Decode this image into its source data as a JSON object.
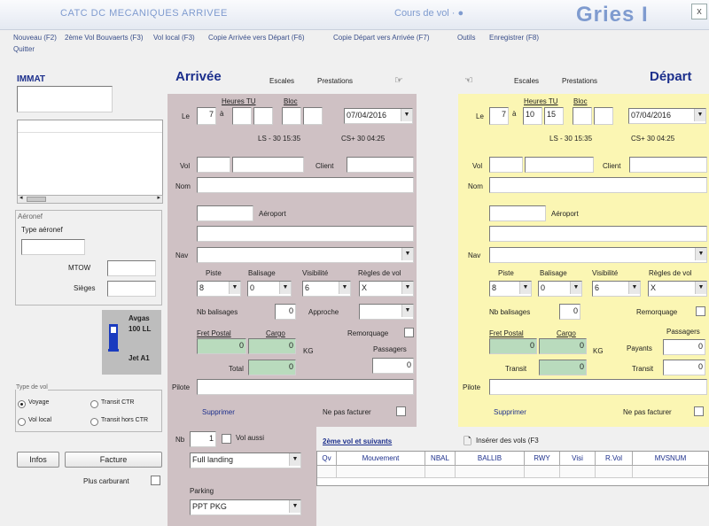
{
  "window": {
    "title": "CATC DC MECANIQUES ARRIVEE",
    "title_mid": "Cours de vol · ●",
    "title_big": "Gries I",
    "close_label": "x"
  },
  "menu": {
    "items": [
      "Nouveau (F2)",
      "2ème Vol Bouvaerts (F3)",
      "Vol local (F3)",
      "Copie Arrivée vers Départ (F6)",
      "Copie Départ vers Arrivée (F7)",
      "Outils",
      "Enregistrer (F8)"
    ],
    "quit": "Quitter"
  },
  "left": {
    "immat_label": "IMMAT",
    "aircraft_label": "Aéronef",
    "aircraft_type_label": "Type aéronef",
    "mtow_label": "MTOW",
    "seats_label": "Sièges",
    "fuel_avgas": "Avgas",
    "fuel_100ll": "100 LL",
    "fuel_jet": "Jet A1",
    "flight_type_legend": "Type de vol",
    "flight_types": [
      "Voyage",
      "Transit CTR",
      "Vol local",
      "Transit hors CTR"
    ],
    "flight_type_selected": "Voyage",
    "infos_button": "Infos",
    "facture_button": "Facture",
    "plus_carburant_label": "Plus carburant"
  },
  "arrival": {
    "title": "Arrivée",
    "escales": "Escales",
    "prestations": "Prestations",
    "heures_tu": "Heures TU",
    "bloc": "Bloc",
    "le_label": "Le",
    "day": "7",
    "a_label": "à",
    "hour": "",
    "minute": "",
    "bloc_h": "",
    "bloc_m": "",
    "date": "07/04/2016",
    "ls": "LS - 30  15:35",
    "cs": "CS+ 30  04:25",
    "vol_label": "Vol",
    "client_label": "Client",
    "nom_label": "Nom",
    "aeroport_label": "Aéroport",
    "nav_label": "Nav",
    "piste_label": "Piste",
    "balisage_label": "Balisage",
    "visibilite_label": "Visibilité",
    "regles_label": "Règles de vol",
    "piste_value": "8",
    "balisage_value": "0",
    "visibilite_value": "6",
    "regles_value": "X",
    "nb_balisages_label": "Nb balisages",
    "nb_balisages_value": "0",
    "approche_label": "Approche",
    "remorquage_label": "Remorquage",
    "fret_postal_label": "Fret Postal",
    "cargo_label": "Cargo",
    "fret_value": "0",
    "cargo_value": "0",
    "kg_label": "KG",
    "passagers_label": "Passagers",
    "passagers_value": "0",
    "total_label": "Total",
    "total_value": "0",
    "pilote_label": "Pilote",
    "supprimer_label": "Supprimer",
    "ne_pas_facturer_label": "Ne pas facturer"
  },
  "departure": {
    "title": "Départ",
    "escales": "Escales",
    "prestations": "Prestations",
    "heures_tu": "Heures TU",
    "bloc": "Bloc",
    "le_label": "Le",
    "day": "7",
    "a_label": "à",
    "hour": "10",
    "minute": "15",
    "bloc_h": "",
    "bloc_m": "",
    "date": "07/04/2016",
    "ls": "LS - 30  15:35",
    "cs": "CS+ 30  04:25",
    "vol_label": "Vol",
    "client_label": "Client",
    "nom_label": "Nom",
    "aeroport_label": "Aéroport",
    "nav_label": "Nav",
    "piste_label": "Piste",
    "balisage_label": "Balisage",
    "visibilite_label": "Visibilité",
    "regles_label": "Règles de vol",
    "piste_value": "8",
    "balisage_value": "0",
    "visibilite_value": "6",
    "regles_value": "X",
    "nb_balisages_label": "Nb balisages",
    "nb_balisages_value": "0",
    "remorquage_label": "Remorquage",
    "fret_postal_label": "Fret Postal",
    "cargo_label": "Cargo",
    "fret_value": "0",
    "cargo_value": "0",
    "kg_label": "KG",
    "passagers_label": "Passagers",
    "payants_label": "Payants",
    "payants_value": "0",
    "transit_label": "Transit",
    "transit_left_value": "0",
    "transit_right_value": "0",
    "pilote_label": "Pilote",
    "supprimer_label": "Supprimer",
    "ne_pas_facturer_label": "Ne pas facturer"
  },
  "bottom": {
    "nb_label": "Nb",
    "nb_value": "1",
    "vol_aussi_label": "Vol aussi",
    "landing_type": "Full landing",
    "parking_label": "Parking",
    "parking_value": "PPT PKG",
    "second_flights_label": "2ème vol et suivants",
    "insert_label": "Insérer des vols (F3",
    "grid_headers": [
      "Qv",
      "Mouvement",
      "NBAL",
      "BALLIB",
      "RWY",
      "Visi",
      "R.Vol",
      "MVSNUM"
    ]
  },
  "colors": {
    "arrival_panel": "#cfc1c4",
    "departure_panel": "#fbf6b3",
    "title_blue": "#1c2f8c",
    "green_field": "#b9dbbd"
  }
}
